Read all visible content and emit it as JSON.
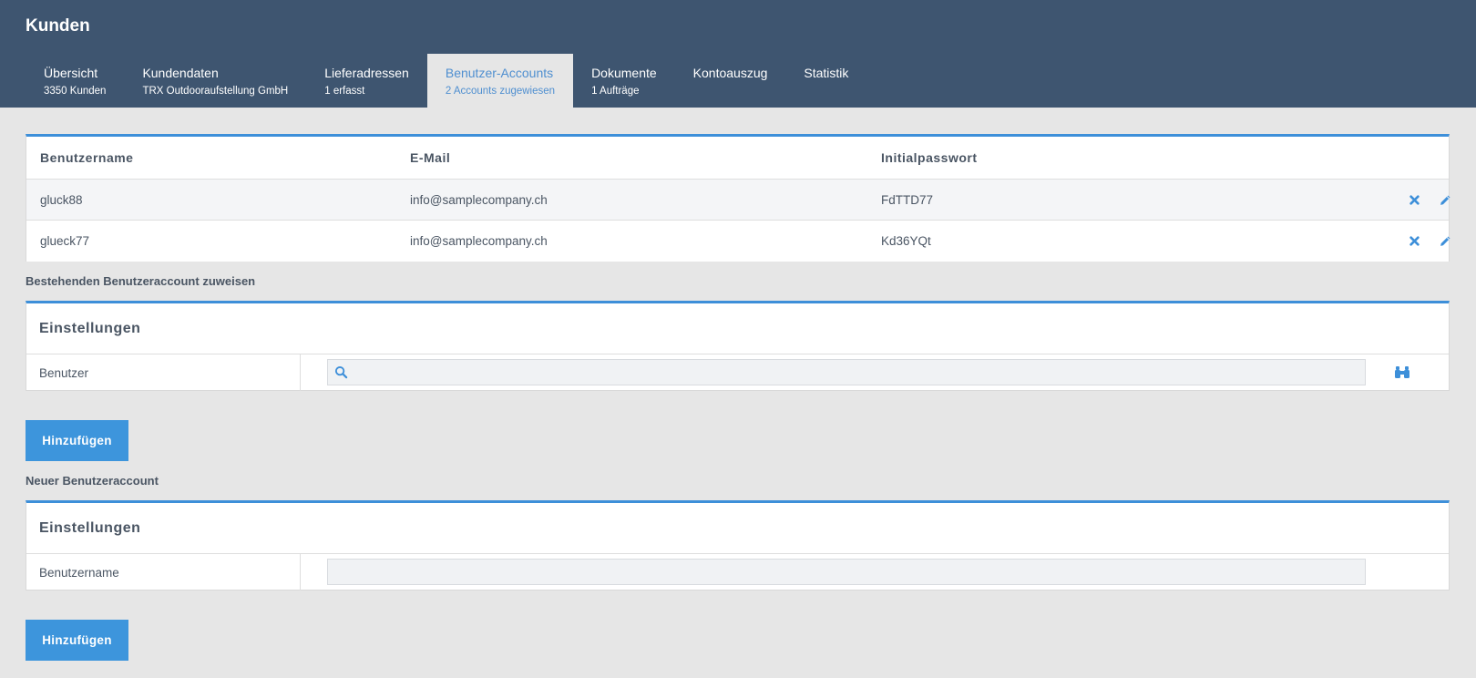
{
  "header": {
    "title": "Kunden"
  },
  "tabs": [
    {
      "label": "Übersicht",
      "sub": "3350 Kunden"
    },
    {
      "label": "Kundendaten",
      "sub": "TRX Outdooraufstellung GmbH"
    },
    {
      "label": "Lieferadressen",
      "sub": "1 erfasst"
    },
    {
      "label": "Benutzer-Accounts",
      "sub": "2 Accounts zugewiesen"
    },
    {
      "label": "Dokumente",
      "sub": "1 Aufträge"
    },
    {
      "label": "Kontoauszug",
      "sub": ""
    },
    {
      "label": "Statistik",
      "sub": ""
    }
  ],
  "accounts_table": {
    "columns": [
      "Benutzername",
      "E-Mail",
      "Initialpasswort"
    ],
    "rows": [
      {
        "username": "gluck88",
        "email": "info@samplecompany.ch",
        "password": "FdTTD77"
      },
      {
        "username": "glueck77",
        "email": "info@samplecompany.ch",
        "password": "Kd36YQt"
      }
    ]
  },
  "assign_section": {
    "label": "Bestehenden Benutzeraccount zuweisen",
    "panel_title": "Einstellungen",
    "field_label": "Benutzer",
    "field_value": "",
    "button": "Hinzufügen"
  },
  "new_section": {
    "label": "Neuer Benutzeraccount",
    "panel_title": "Einstellungen",
    "field_label": "Benutzername",
    "field_value": "",
    "button": "Hinzufügen"
  },
  "colors": {
    "header_bg": "#3e5570",
    "accent": "#3d95dc",
    "page_bg": "#e6e6e6"
  },
  "icons": [
    "search-icon",
    "binoculars-icon",
    "delete-icon",
    "edit-icon"
  ]
}
